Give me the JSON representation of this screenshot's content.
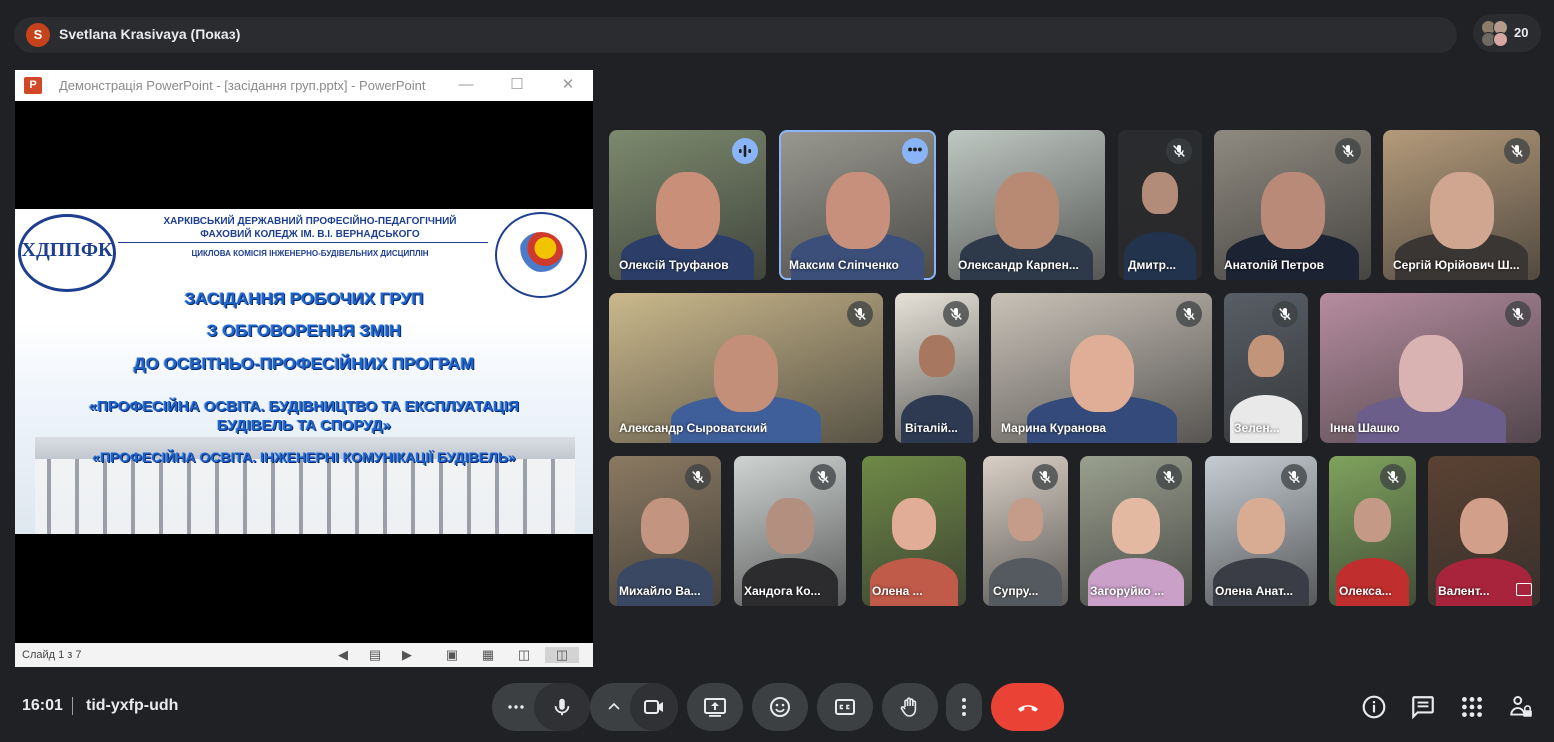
{
  "topbar": {
    "avatar_letter": "S",
    "presenter": "Svetlana Krasivaya (Показ)",
    "participant_count": "20"
  },
  "ppt": {
    "window_title": "Демонстрація PowerPoint - [засідання груп.pptx] - PowerPoint",
    "logo_letter": "P",
    "slide": {
      "header_line1": "ХАРКІВСЬКИЙ ДЕРЖАВНИЙ ПРОФЕСІЙНО-ПЕДАГОГІЧНИЙ",
      "header_line2": "ФАХОВИЙ КОЛЕДЖ ІМ. В.І. ВЕРНАДСЬКОГО",
      "commission": "ЦИКЛОВА КОМІСІЯ ІНЖЕНЕРНО-БУДІВЕЛЬНИХ ДИСЦИПЛІН",
      "logo_text": "ХДППФК",
      "title1": "ЗАСІДАННЯ РОБОЧИХ ГРУП",
      "title2": "З ОБГОВОРЕННЯ ЗМІН",
      "title3": "ДО ОСВІТНЬО-ПРОФЕСІЙНИХ ПРОГРАМ",
      "program1a": "«ПРОФЕСІЙНА ОСВІТА. БУДІВНИЦТВО ТА ЕКСПЛУАТАЦІЯ",
      "program1b": "БУДІВЕЛЬ ТА СПОРУД»",
      "program2": "«ПРОФЕСІЙНА ОСВІТА. ІНЖЕНЕРНІ КОМУНІКАЦІЇ БУДІВЕЛЬ»"
    },
    "status": {
      "slide_counter": "Слайд 1 з 7"
    }
  },
  "participants": [
    {
      "name": "Олексій Труфанов",
      "bg": "#7c8a6e",
      "skin": "#c98f78",
      "shirt": "#2c3e68",
      "indicator": "speaking"
    },
    {
      "name": "Максим Сліпченко",
      "bg": "#9a9990",
      "skin": "#c6907c",
      "shirt": "#3b4f7a",
      "indicator": "more"
    },
    {
      "name": "Олександр Карпен...",
      "bg": "#bfc8c2",
      "skin": "#b88a74",
      "shirt": "#2e3a4a",
      "indicator": "none"
    },
    {
      "name": "Дмитр...",
      "bg": "#2a2b2e",
      "skin": "#b28b79",
      "shirt": "#22334d",
      "indicator": "muted"
    },
    {
      "name": "Анатолій Петров",
      "bg": "#8f8a80",
      "skin": "#b98a78",
      "shirt": "#1c2333",
      "indicator": "muted"
    },
    {
      "name": "Сергій Юрійович Ш...",
      "bg": "#b49a7a",
      "skin": "#d0a690",
      "shirt": "#3a3633",
      "indicator": "muted"
    },
    {
      "name": "Александр Сыроватский",
      "bg": "#cbb98c",
      "skin": "#c48f79",
      "shirt": "#3f5f9a",
      "indicator": "muted"
    },
    {
      "name": "Віталій...",
      "bg": "#e6e2d8",
      "skin": "#a7775f",
      "shirt": "#2e3a52",
      "indicator": "muted"
    },
    {
      "name": "Марина Куранова",
      "bg": "#c9c2b8",
      "skin": "#e0ad97",
      "shirt": "#334a7a",
      "indicator": "muted"
    },
    {
      "name": "Зелен...",
      "bg": "#585e66",
      "skin": "#c29479",
      "shirt": "#e9e9e9",
      "indicator": "muted"
    },
    {
      "name": "Інна Шашко",
      "bg": "#b68d9f",
      "skin": "#d9b3b1",
      "shirt": "#6c5e8a",
      "indicator": "muted"
    },
    {
      "name": "Михайло Ва...",
      "bg": "#8b7a62",
      "skin": "#c39580",
      "shirt": "#3a4863",
      "indicator": "muted"
    },
    {
      "name": "Хандога Ко...",
      "bg": "#cfd4d2",
      "skin": "#b38f7f",
      "shirt": "#2c2c2e",
      "indicator": "muted"
    },
    {
      "name": "Олена ...",
      "bg": "#6f8a47",
      "skin": "#e2ad97",
      "shirt": "#c05a49",
      "indicator": "none"
    },
    {
      "name": "Супру...",
      "bg": "#d9d0c6",
      "skin": "#c59c8a",
      "shirt": "#555a60",
      "indicator": "muted"
    },
    {
      "name": "Загоруйко ...",
      "bg": "#9aa08f",
      "skin": "#e3b9a2",
      "shirt": "#caa0c8",
      "indicator": "muted"
    },
    {
      "name": "Олена Анат...",
      "bg": "#c5ccd2",
      "skin": "#d8ab93",
      "shirt": "#3a3d45",
      "indicator": "muted"
    },
    {
      "name": "Олекса...",
      "bg": "#7fa35d",
      "skin": "#c49a86",
      "shirt": "#c02f2d",
      "indicator": "muted"
    },
    {
      "name": "Валент...",
      "bg": "#5b4232",
      "skin": "#d2a08a",
      "shirt": "#a8243c",
      "indicator": "pin"
    }
  ],
  "bottom": {
    "time": "16:01",
    "meeting_code": "tid-yxfp-udh"
  },
  "colors": {
    "bg": "#202124",
    "control": "#3c4043",
    "leave": "#ea4335",
    "accent": "#8ab4f8"
  }
}
